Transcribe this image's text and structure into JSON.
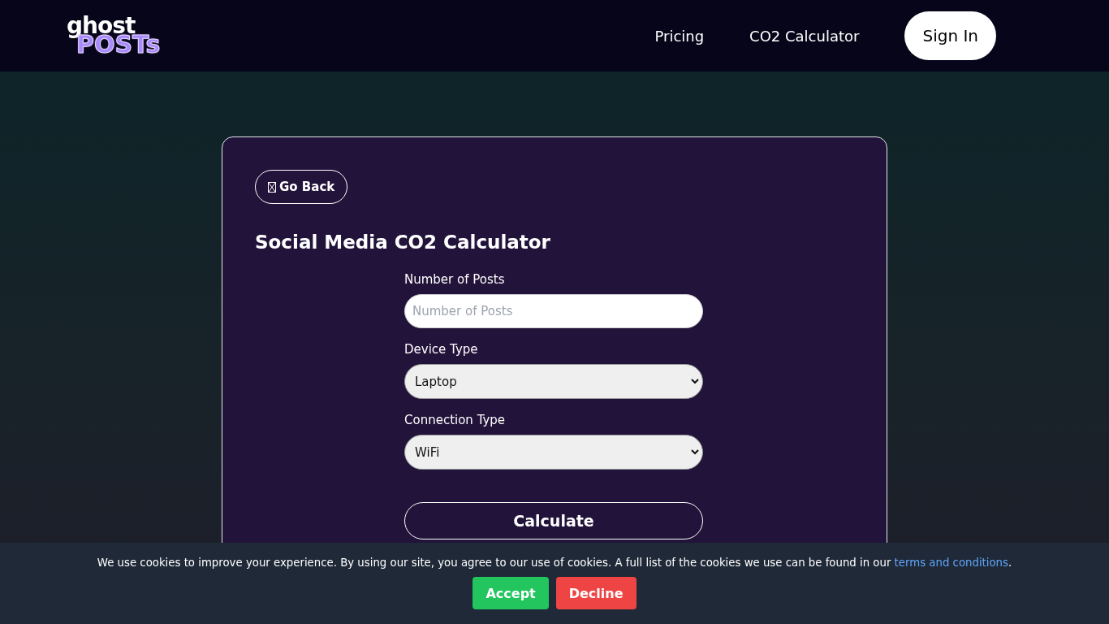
{
  "logo": {
    "top": "ghost",
    "bottom": "POSTs"
  },
  "nav": {
    "links": [
      "Pricing",
      "CO2 Calculator"
    ],
    "sign_in": "Sign In"
  },
  "card": {
    "back": "Go Back",
    "title": "Social Media CO2 Calculator",
    "fields": [
      {
        "kind": "input",
        "label": "Number of Posts",
        "placeholder": "Number of Posts"
      },
      {
        "kind": "select",
        "label": "Device Type",
        "value": "Laptop"
      },
      {
        "kind": "select",
        "label": "Connection Type",
        "value": "WiFi"
      }
    ],
    "submit": "Calculate"
  },
  "cookie": {
    "text": "We use cookies to improve your experience. By using our site, you agree to our use of cookies. A full list of the cookies we use can be found in our",
    "link": "terms and conditions",
    "end": ".",
    "accept": "Accept",
    "decline": "Decline"
  }
}
